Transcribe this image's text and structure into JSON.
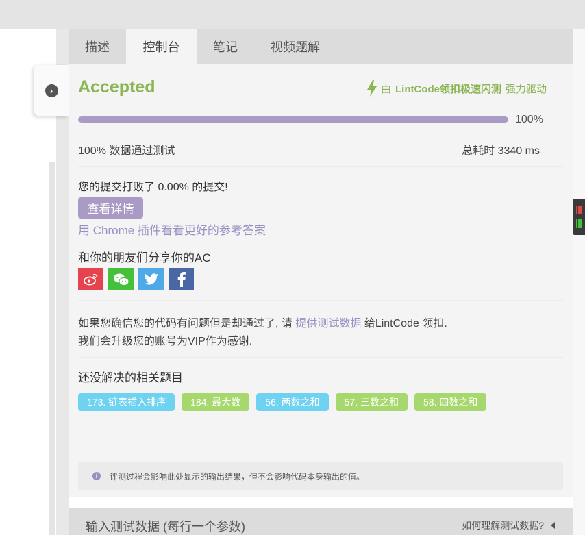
{
  "tabs": [
    {
      "label": "描述",
      "active": false
    },
    {
      "label": "控制台",
      "active": true
    },
    {
      "label": "笔记",
      "active": false
    },
    {
      "label": "视频题解",
      "active": false
    }
  ],
  "result": {
    "status": "Accepted",
    "powered_prefix": "由",
    "powered_brand": "LintCode领扣极速闪测",
    "powered_suffix": "强力驱动",
    "progress_percent": 100,
    "progress_text": "100%",
    "tests_passed_text": "100% 数据通过测试",
    "total_time_text": "总耗时 3340 ms"
  },
  "beat": {
    "text": "您的提交打败了 0.00% 的提交!",
    "detail_button": "查看详情",
    "chrome_link": "用 Chrome 插件看看更好的参考答案"
  },
  "share": {
    "text": "和你的朋友们分享你的AC",
    "buttons": [
      "weibo-icon",
      "wechat-icon",
      "twitter-icon",
      "facebook-icon"
    ]
  },
  "issue": {
    "line1_prefix": "如果您确信您的代码有问题但是却通过了, 请",
    "line1_link": "提供测试数据",
    "line1_suffix": "给LintCode 领扣.",
    "line2": "我们会升级您的账号为VIP作为感谢."
  },
  "related": {
    "title": "还没解决的相关题目",
    "tags": [
      {
        "label": "173. 链表插入排序",
        "color": "#6fd2f0"
      },
      {
        "label": "184. 最大数",
        "color": "#a6d86e"
      },
      {
        "label": "56. 两数之和",
        "color": "#6fd2f0"
      },
      {
        "label": "57. 三数之和",
        "color": "#a6d86e"
      },
      {
        "label": "58. 四数之和",
        "color": "#a6d86e"
      }
    ]
  },
  "notice": {
    "icon": "info-icon",
    "text": "评测过程会影响此处显示的输出结果，但不会影响代码本身输出的值。"
  },
  "input_section": {
    "title": "输入测试数据 (每行一个参数)",
    "help": "如何理解测试数据?"
  },
  "colors": {
    "accent_green": "#8ab552",
    "accent_purple": "#a99bc5",
    "link_purple": "#9b8fc2"
  }
}
